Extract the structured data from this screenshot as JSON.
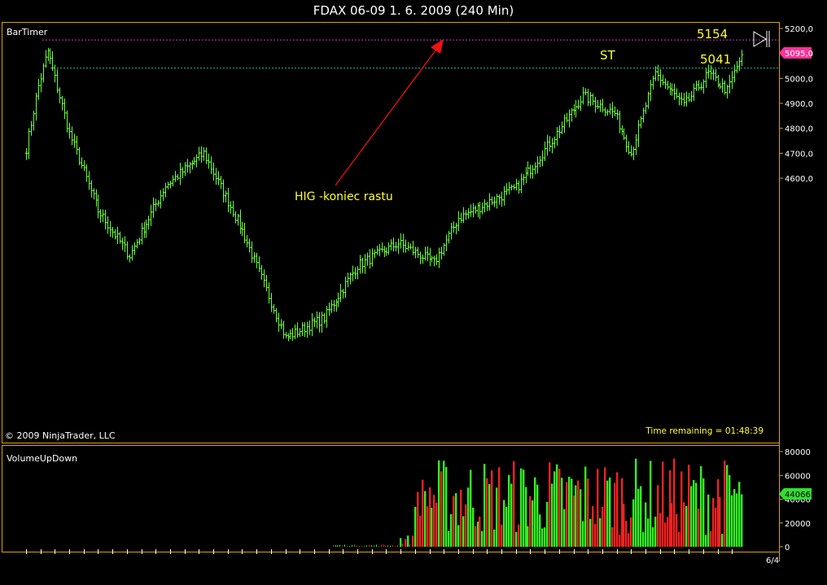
{
  "window": {
    "title": "FDAX 06-09  1. 6. 2009 (240 Min)"
  },
  "colors": {
    "background": "#000000",
    "frame": "#d9a400",
    "price_bars": "#66ff33",
    "volume_up": "#33ee22",
    "volume_down": "#ee2222",
    "high_line": "#cc33cc",
    "st_line": "#20c0a8",
    "annotation_text": "#ffff33",
    "arrow": "#ee1111",
    "price_badge": "#ff3399",
    "volume_badge": "#33dd33"
  },
  "price_panel": {
    "indicator_label": "BarTimer",
    "copyright": "© 2009 NinjaTrader, LLC",
    "time_remaining": "Time remaining = 01:48:39",
    "current_price_badge": "5095,0"
  },
  "volume_panel": {
    "indicator_label": "VolumeUpDown",
    "current_volume_badge": "44066"
  },
  "annotations": {
    "high_label": "5154",
    "st_label": "ST",
    "st_value": "5041",
    "arrow_text": "HIG -koniec rastu"
  },
  "chart_data": [
    {
      "type": "ohlc",
      "title": "FDAX 06-09  1. 6. 2009 (240 Min)",
      "y_tick_labels": [
        "5200,0",
        "5100,0",
        "5000,0",
        "4900,0",
        "4800,0",
        "4700,0",
        "4600,0"
      ],
      "ylim": [
        3800,
        5230
      ],
      "horizontal_lines": [
        {
          "label": "5154",
          "value": 5154
        },
        {
          "label": "5041",
          "value": 5041
        }
      ],
      "last_price": 5095,
      "close_path_approx": [
        {
          "bar": 0,
          "close": 4720
        },
        {
          "bar": 5,
          "close": 4970
        },
        {
          "bar": 9,
          "close": 5110
        },
        {
          "bar": 18,
          "close": 4780
        },
        {
          "bar": 30,
          "close": 4470
        },
        {
          "bar": 43,
          "close": 4290
        },
        {
          "bar": 58,
          "close": 4570
        },
        {
          "bar": 74,
          "close": 4700
        },
        {
          "bar": 90,
          "close": 4390
        },
        {
          "bar": 108,
          "close": 3960
        },
        {
          "bar": 124,
          "close": 4040
        },
        {
          "bar": 138,
          "close": 4250
        },
        {
          "bar": 155,
          "close": 4340
        },
        {
          "bar": 170,
          "close": 4260
        },
        {
          "bar": 180,
          "close": 4440
        },
        {
          "bar": 192,
          "close": 4500
        },
        {
          "bar": 204,
          "close": 4560
        },
        {
          "bar": 218,
          "close": 4740
        },
        {
          "bar": 232,
          "close": 4930
        },
        {
          "bar": 245,
          "close": 4860
        },
        {
          "bar": 252,
          "close": 4700
        },
        {
          "bar": 262,
          "close": 5020
        },
        {
          "bar": 274,
          "close": 4890
        },
        {
          "bar": 284,
          "close": 5020
        },
        {
          "bar": 292,
          "close": 4950
        },
        {
          "bar": 298,
          "close": 5095
        }
      ]
    },
    {
      "type": "bar",
      "name": "VolumeUpDown",
      "y_tick_labels": [
        "80000",
        "60000",
        "40000",
        "20000",
        "0"
      ],
      "ylim": [
        0,
        80000
      ],
      "x_tick_label": "6/4",
      "last_volume": 44066
    }
  ]
}
